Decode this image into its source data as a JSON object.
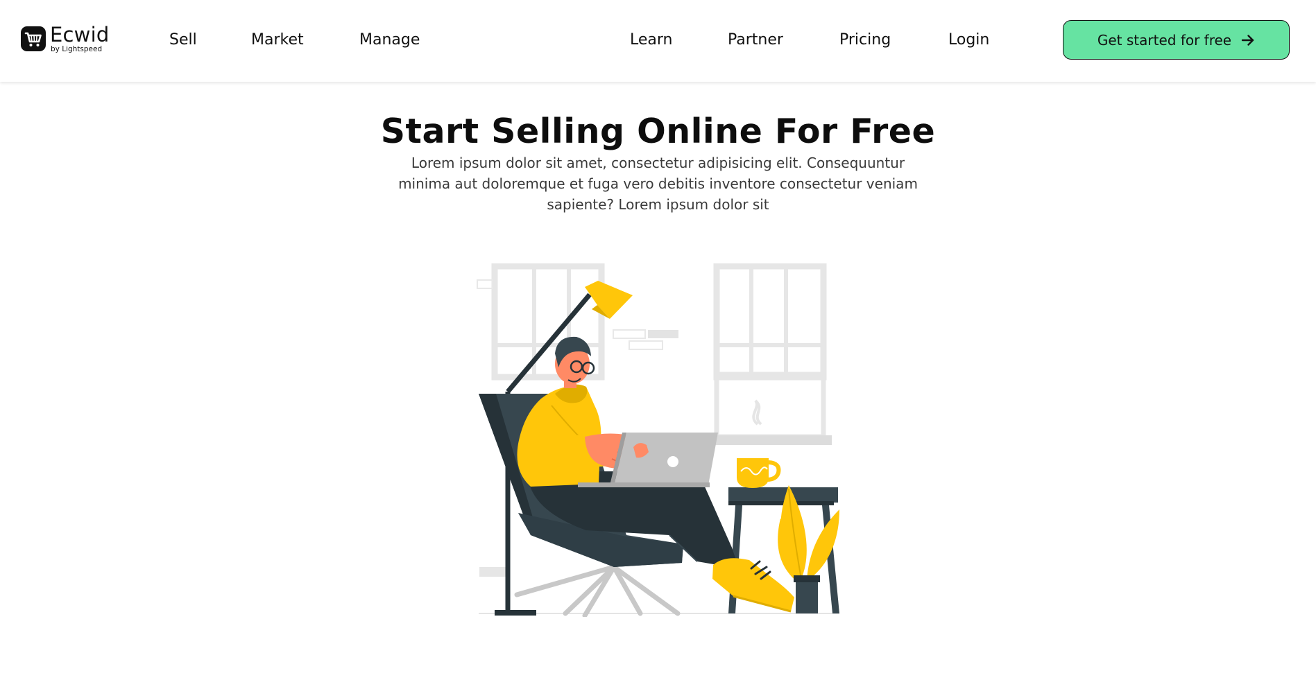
{
  "brand": {
    "name": "Ecwid",
    "tagline": "by Lightspeed"
  },
  "nav": {
    "left": [
      "Sell",
      "Market",
      "Manage"
    ],
    "right": [
      "Learn",
      "Partner",
      "Pricing",
      "Login"
    ]
  },
  "cta": {
    "label": "Get started for free",
    "icon": "arrow-right-icon",
    "color": "#66e3a2"
  },
  "hero": {
    "title": "Start Selling Online For Free",
    "description": "Lorem ipsum dolor sit amet, consectetur adipisicing elit. Consequuntur minima aut doloremque et fuga vero debitis inventore consectetur veniam sapiente? Lorem ipsum dolor sit"
  },
  "illustration": {
    "subject": "person-with-laptop-in-armchair",
    "accent_color": "#ffc60a",
    "dark_color": "#263238"
  }
}
